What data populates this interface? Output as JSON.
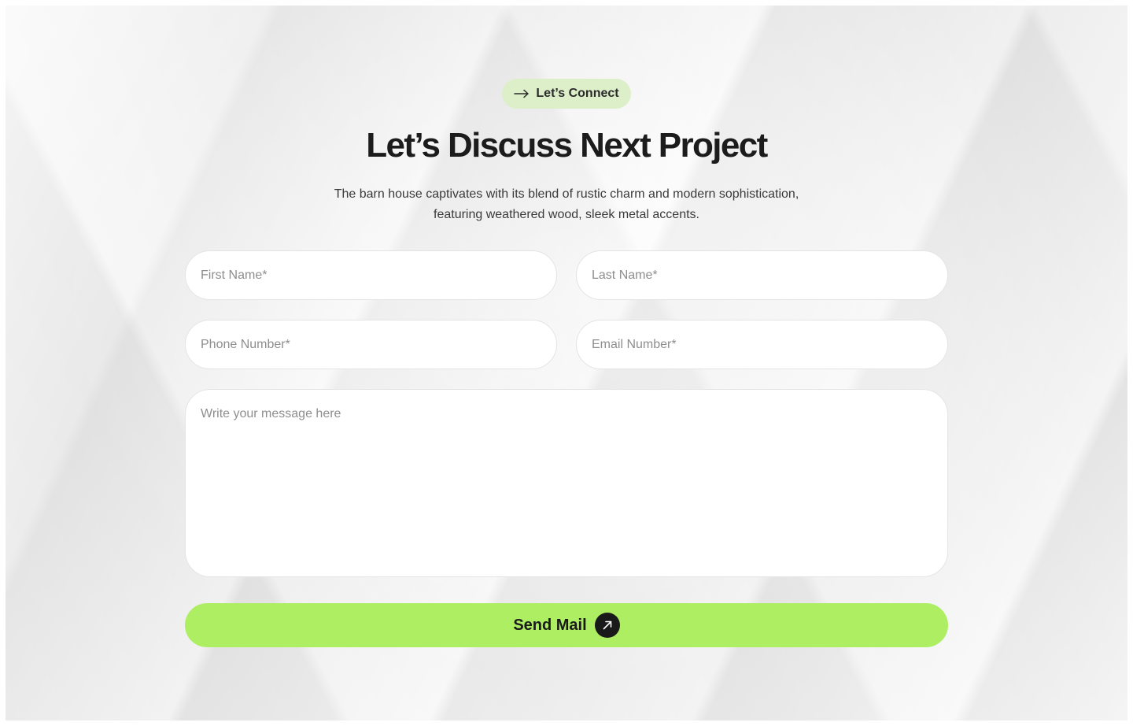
{
  "badge": {
    "icon": "arrow-right-icon",
    "label": "Let’s Connect"
  },
  "heading": "Let’s Discuss Next Project",
  "description": {
    "line1": "The barn house captivates with its blend of rustic charm and modern sophistication,",
    "line2": "featuring weathered wood, sleek metal accents."
  },
  "form": {
    "first_name_placeholder": "First Name*",
    "last_name_placeholder": "Last Name*",
    "phone_placeholder": "Phone Number*",
    "email_placeholder": "Email Number*",
    "message_placeholder": "Write your message here",
    "submit_label": "Send Mail",
    "submit_icon": "arrow-up-right-icon"
  },
  "colors": {
    "accent": "#adee62",
    "badge_bg": "#dcefc8",
    "text_dark": "#1c1c1c"
  }
}
